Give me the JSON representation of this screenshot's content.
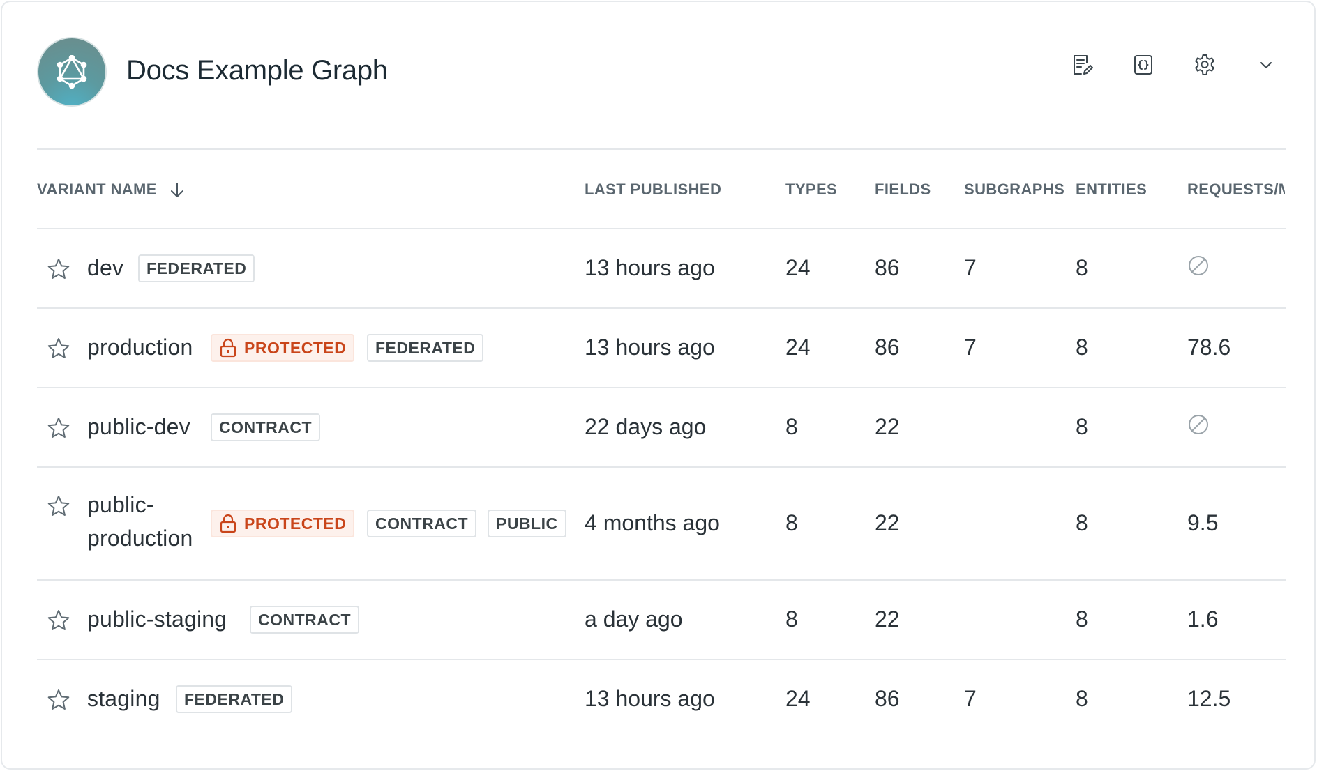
{
  "graph": {
    "title": "Docs Example Graph"
  },
  "toolbar": {
    "icons": [
      "readme-edit-icon",
      "schema-icon",
      "gear-icon",
      "chevron-down-icon"
    ]
  },
  "table": {
    "columns": {
      "variant_name": "VARIANT NAME",
      "last_published": "LAST PUBLISHED",
      "types": "TYPES",
      "fields": "FIELDS",
      "subgraphs": "SUBGRAPHS",
      "entities": "ENTITIES",
      "requests": "REQUESTS/MI"
    },
    "rows": [
      {
        "name": "dev",
        "badges": [
          "FEDERATED"
        ],
        "last_published": "13 hours ago",
        "types": "24",
        "fields": "86",
        "subgraphs": "7",
        "entities": "8",
        "requests": ""
      },
      {
        "name": "production",
        "protected": "PROTECTED",
        "badges": [
          "FEDERATED"
        ],
        "last_published": "13 hours ago",
        "types": "24",
        "fields": "86",
        "subgraphs": "7",
        "entities": "8",
        "requests": "78.6"
      },
      {
        "name": "public-dev",
        "badges": [
          "CONTRACT"
        ],
        "last_published": "22 days ago",
        "types": "8",
        "fields": "22",
        "subgraphs": "",
        "entities": "8",
        "requests": ""
      },
      {
        "name_line1": "public-",
        "name_line2": "production",
        "protected": "PROTECTED",
        "badges": [
          "CONTRACT",
          "PUBLIC"
        ],
        "last_published": "4 months ago",
        "types": "8",
        "fields": "22",
        "subgraphs": "",
        "entities": "8",
        "requests": "9.5"
      },
      {
        "name": "public-staging",
        "badges": [
          "CONTRACT"
        ],
        "last_published": "a day ago",
        "types": "8",
        "fields": "22",
        "subgraphs": "",
        "entities": "8",
        "requests": "1.6"
      },
      {
        "name": "staging",
        "badges": [
          "FEDERATED"
        ],
        "last_published": "13 hours ago",
        "types": "24",
        "fields": "86",
        "subgraphs": "7",
        "entities": "8",
        "requests": "12.5"
      }
    ]
  },
  "colors": {
    "protected_text": "#c9451a",
    "protected_bg": "#fdf1ec",
    "divider": "#e4e7ea"
  }
}
